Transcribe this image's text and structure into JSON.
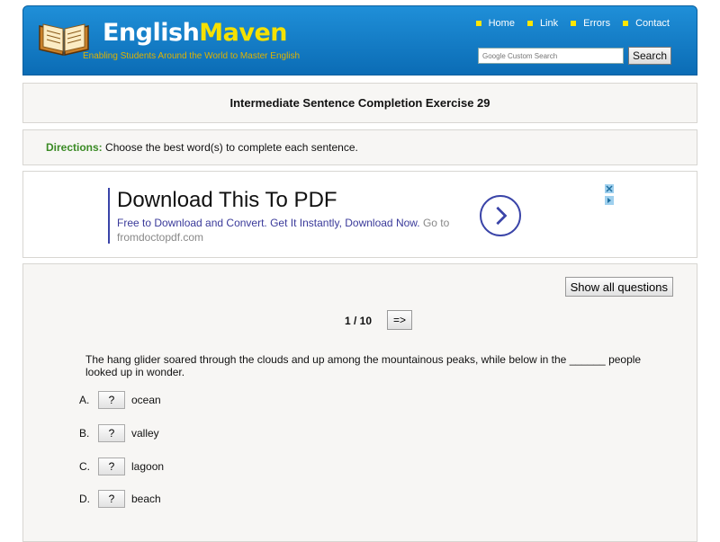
{
  "header": {
    "logo_main": "English",
    "logo_accent": "Maven",
    "tagline": "Enabling Students Around the World to Master English",
    "nav": [
      "Home",
      "Link",
      "Errors",
      "Contact"
    ],
    "search_placeholder": "Google Custom Search",
    "search_button": "Search",
    "colors": {
      "bar": "#1180d0",
      "accent": "#f5e100"
    }
  },
  "title": "Intermediate Sentence Completion Exercise 29",
  "directions": {
    "label": "Directions:",
    "text": " Choose the best word(s) to complete each sentence."
  },
  "ad": {
    "title": "Download This To PDF",
    "description": "Free to Download and Convert. Get It Instantly, Download Now.",
    "more": " Go to fromdoctopdf.com"
  },
  "quiz": {
    "show_all": "Show all questions",
    "counter": "1 / 10",
    "next": "=>",
    "question": "The hang glider soared through the clouds and up among the mountainous peaks, while below in the ______ people looked up in wonder.",
    "options": [
      {
        "letter": "A.",
        "button": "?",
        "text": "ocean"
      },
      {
        "letter": "B.",
        "button": "?",
        "text": "valley"
      },
      {
        "letter": "C.",
        "button": "?",
        "text": "lagoon"
      },
      {
        "letter": "D.",
        "button": "?",
        "text": "beach"
      }
    ]
  }
}
